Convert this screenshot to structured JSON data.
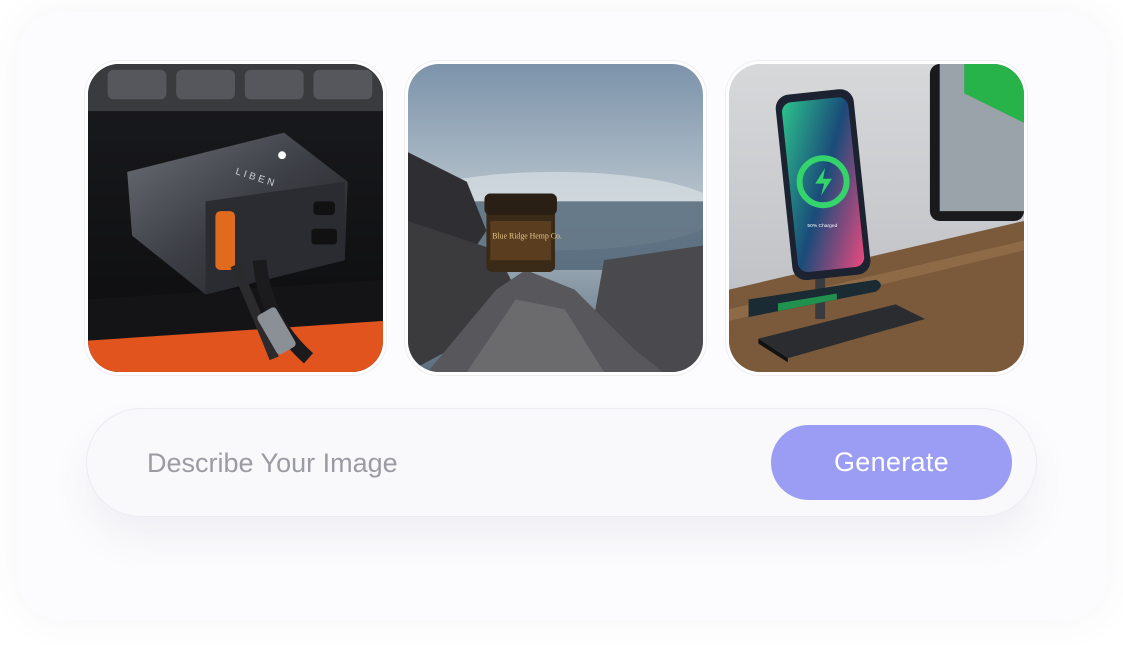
{
  "gallery": {
    "images": [
      {
        "icon": "usb-car-charger-photo",
        "label_text": "LIBEN"
      },
      {
        "icon": "product-jar-on-rock-photo",
        "label_text": "Blue Ridge Hemp Co."
      },
      {
        "icon": "wireless-charging-stand-photo",
        "label_text": "50% Charged"
      }
    ]
  },
  "prompt": {
    "placeholder": "Describe Your Image",
    "value": ""
  },
  "generate": {
    "label": "Generate",
    "color": "#9b9cf4"
  }
}
